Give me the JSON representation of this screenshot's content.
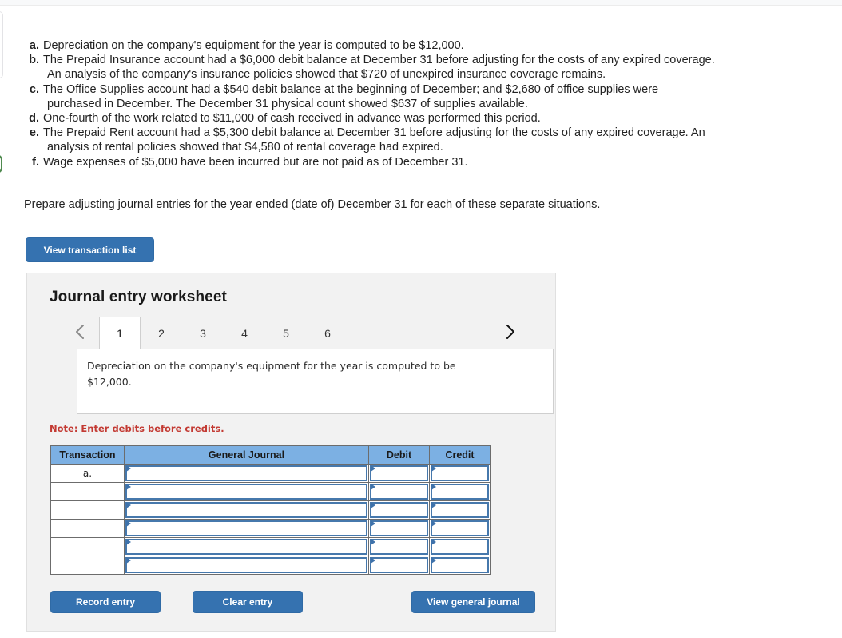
{
  "situations": [
    {
      "label": "a.",
      "lines": [
        "Depreciation on the company's equipment for the year is computed to be $12,000."
      ]
    },
    {
      "label": "b.",
      "lines": [
        "The Prepaid Insurance account had a $6,000 debit balance at December 31 before adjusting for the costs of any expired coverage.",
        "An analysis of the company's insurance policies showed that $720 of unexpired insurance coverage remains."
      ]
    },
    {
      "label": "c.",
      "lines": [
        "The Office Supplies account had a $540 debit balance at the beginning of December; and $2,680 of office supplies were",
        "purchased in December. The December 31 physical count showed $637 of supplies available."
      ]
    },
    {
      "label": "d.",
      "lines": [
        "One-fourth of the work related to $11,000 of cash received in advance was performed this period."
      ]
    },
    {
      "label": "e.",
      "lines": [
        "The Prepaid Rent account had a $5,300 debit balance at December 31 before adjusting for the costs of any expired coverage. An",
        "analysis of rental policies showed that $4,580 of rental coverage had expired."
      ]
    },
    {
      "label": "f.",
      "lines": [
        "Wage expenses of $5,000 have been incurred but are not paid as of December 31."
      ]
    }
  ],
  "prompt": "Prepare adjusting journal entries for the year ended (date of) December 31 for each of these separate situations.",
  "view_transaction_list_label": "View transaction list",
  "worksheet": {
    "title": "Journal entry worksheet",
    "prev_arrow_icon": "chevron-left-icon",
    "next_arrow_icon": "chevron-right-icon",
    "tabs": [
      {
        "label": "1",
        "active": true
      },
      {
        "label": "2",
        "active": false
      },
      {
        "label": "3",
        "active": false
      },
      {
        "label": "4",
        "active": false
      },
      {
        "label": "5",
        "active": false
      },
      {
        "label": "6",
        "active": false
      }
    ],
    "active_tab": "1",
    "description": "Depreciation on the company's equipment for the year is computed to be $12,000.",
    "note": "Note: Enter debits before credits.",
    "table": {
      "headers": [
        "Transaction",
        "General Journal",
        "Debit",
        "Credit"
      ],
      "rows": [
        {
          "transaction": "a.",
          "general_journal": "",
          "debit": "",
          "credit": ""
        },
        {
          "transaction": "",
          "general_journal": "",
          "debit": "",
          "credit": ""
        },
        {
          "transaction": "",
          "general_journal": "",
          "debit": "",
          "credit": ""
        },
        {
          "transaction": "",
          "general_journal": "",
          "debit": "",
          "credit": ""
        },
        {
          "transaction": "",
          "general_journal": "",
          "debit": "",
          "credit": ""
        },
        {
          "transaction": "",
          "general_journal": "",
          "debit": "",
          "credit": ""
        }
      ]
    },
    "buttons": {
      "record_entry": "Record entry",
      "clear_entry": "Clear entry",
      "view_general_journal": "View general journal"
    }
  },
  "colors": {
    "button_blue": "#3572b0",
    "table_header_blue": "#7cb0e3",
    "cell_border_blue": "#4678ac",
    "note_red": "#c33a33",
    "panel_gray": "#f2f2f2"
  }
}
